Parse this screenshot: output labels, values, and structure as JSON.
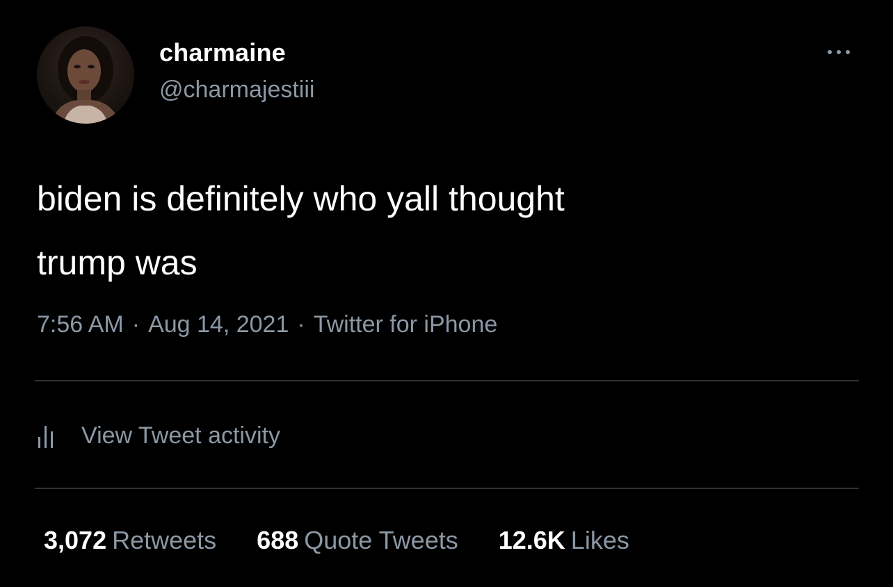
{
  "author": {
    "display_name": "charmaine",
    "handle": "@charmajestiii"
  },
  "tweet": {
    "text": "biden is definitely who yall thought\ntrump was",
    "time": "7:56 AM",
    "date": "Aug 14, 2021",
    "source": "Twitter for iPhone",
    "separator": "·"
  },
  "activity": {
    "label": "View Tweet activity",
    "icon": "bar-chart-icon"
  },
  "stats": {
    "retweets_count": "3,072",
    "retweets_label": "Retweets",
    "quotes_count": "688",
    "quotes_label": "Quote Tweets",
    "likes_count": "12.6K",
    "likes_label": "Likes"
  },
  "icons": {
    "more": "more-options-icon",
    "activity": "bar-chart-icon"
  },
  "colors": {
    "background": "#000000",
    "primary_text": "#ffffff",
    "secondary_text": "#8b98a5",
    "divider": "#2f3336"
  }
}
